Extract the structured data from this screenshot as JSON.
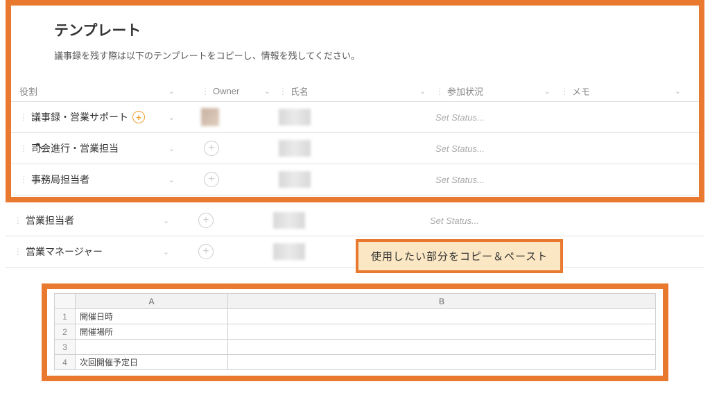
{
  "header": {
    "title": "テンプレート",
    "subtitle": "議事録を残す際は以下のテンプレートをコピーし、情報を残してください。"
  },
  "table": {
    "columns": {
      "role": "役割",
      "owner": "Owner",
      "name": "氏名",
      "status": "参加状況",
      "memo": "メモ"
    },
    "status_placeholder": "Set Status...",
    "rows": [
      {
        "role": "議事録・営業サポート",
        "highlight": true
      },
      {
        "role": "司会進行・営業担当",
        "highlight": false
      },
      {
        "role": "事務局担当者",
        "highlight": false
      },
      {
        "role": "営業担当者",
        "highlight": false
      },
      {
        "role": "営業マネージャー",
        "highlight": false
      }
    ]
  },
  "callout": {
    "text": "使用したい部分をコピー＆ペースト"
  },
  "spreadsheet": {
    "columns": [
      "A",
      "B"
    ],
    "rows": [
      {
        "num": "1",
        "a": "開催日時",
        "b": ""
      },
      {
        "num": "2",
        "a": "開催場所",
        "b": ""
      },
      {
        "num": "3",
        "a": "",
        "b": ""
      },
      {
        "num": "4",
        "a": "次回開催予定日",
        "b": ""
      }
    ]
  }
}
